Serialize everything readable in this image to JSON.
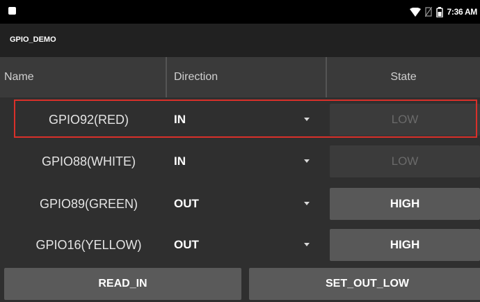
{
  "status_bar": {
    "time": "7:36 AM",
    "icons": [
      "wifi-icon",
      "no-sim-icon",
      "battery-icon"
    ]
  },
  "app_bar": {
    "title": "GPIO_DEMO"
  },
  "table": {
    "headers": {
      "name": "Name",
      "direction": "Direction",
      "state": "State"
    },
    "rows": [
      {
        "name": "GPIO92(RED)",
        "direction": "IN",
        "state": "LOW",
        "state_enabled": false,
        "selected": true
      },
      {
        "name": "GPIO88(WHITE)",
        "direction": "IN",
        "state": "LOW",
        "state_enabled": false,
        "selected": false
      },
      {
        "name": "GPIO89(GREEN)",
        "direction": "OUT",
        "state": "HIGH",
        "state_enabled": true,
        "selected": false
      },
      {
        "name": "GPIO16(YELLOW)",
        "direction": "OUT",
        "state": "HIGH",
        "state_enabled": true,
        "selected": false
      }
    ]
  },
  "buttons": {
    "read_in": "READ_IN",
    "set_out_low": "SET_OUT_LOW"
  },
  "colors": {
    "highlight": "#d9302a",
    "background": "#2f2f2f",
    "header": "#3a3a3a",
    "button": "#5a5a5a"
  }
}
